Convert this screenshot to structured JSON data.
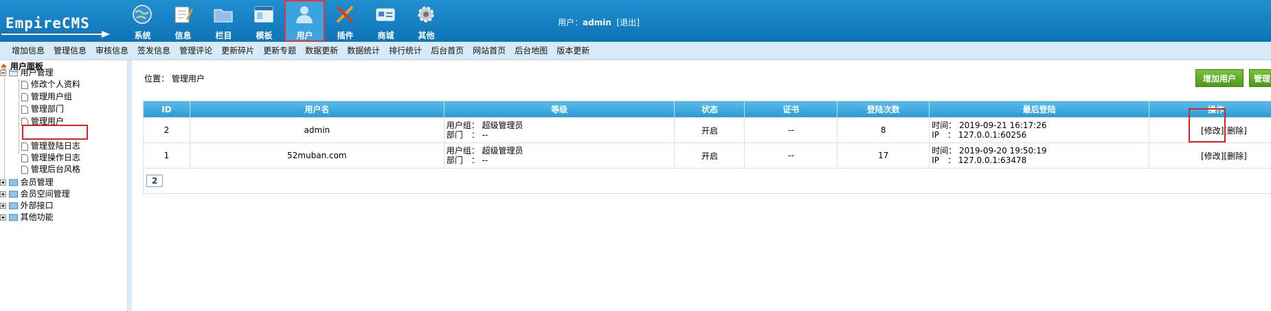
{
  "app": {
    "logo_text": "EmpireCMS"
  },
  "topnav": [
    {
      "key": "system",
      "label": "系统",
      "icon": "globe-icon"
    },
    {
      "key": "info",
      "label": "信息",
      "icon": "notepad-icon"
    },
    {
      "key": "column",
      "label": "栏目",
      "icon": "folder-icon"
    },
    {
      "key": "template",
      "label": "模板",
      "icon": "window-icon"
    },
    {
      "key": "user",
      "label": "用户",
      "icon": "user-icon",
      "active": true
    },
    {
      "key": "plugin",
      "label": "插件",
      "icon": "tools-icon"
    },
    {
      "key": "mall",
      "label": "商城",
      "icon": "card-icon"
    },
    {
      "key": "other",
      "label": "其他",
      "icon": "gear-icon"
    }
  ],
  "user_info": {
    "prefix": "用户：",
    "name": "admin",
    "logout": "[退出]"
  },
  "submenu": [
    "增加信息",
    "管理信息",
    "审核信息",
    "签发信息",
    "管理评论",
    "更新碎片",
    "更新专题",
    "数据更新",
    "数据统计",
    "排行统计",
    "后台首页",
    "网站首页",
    "后台地图",
    "版本更新"
  ],
  "sidebar": {
    "root": "用户面板",
    "group": "用户管理",
    "items": [
      "修改个人资料",
      "管理用户组",
      "管理部门",
      "管理用户",
      "管理登陆日志",
      "管理操作日志",
      "管理后台风格"
    ],
    "selected": "管理用户",
    "others": [
      "会员管理",
      "会员空间管理",
      "外部接口",
      "其他功能"
    ]
  },
  "main": {
    "crumb_label": "位置：",
    "crumb_value": "管理用户",
    "add_button": "增加用户",
    "manage_button": "管理"
  },
  "table": {
    "headers": [
      "ID",
      "用户名",
      "等级",
      "状态",
      "证书",
      "登陆次数",
      "最后登陆",
      "操作"
    ],
    "rows": [
      {
        "id": "2",
        "username": "admin",
        "group": "用户组： 超级管理员",
        "dept": "部门　： --",
        "status": "开启",
        "cert": "--",
        "logins": "8",
        "time": "时间： 2019-09-21 16:17:26",
        "ip": "IP　： 127.0.0.1:60256",
        "edit": "[修改]",
        "del": "[删除]"
      },
      {
        "id": "1",
        "username": "52muban.com",
        "group": "用户组： 超级管理员",
        "dept": "部门　： --",
        "status": "开启",
        "cert": "--",
        "logins": "17",
        "time": "时间： 2019-09-20 19:50:19",
        "ip": "IP　： 127.0.0.1:63478",
        "edit": "[修改]",
        "del": "[删除]"
      }
    ],
    "page": "2"
  }
}
